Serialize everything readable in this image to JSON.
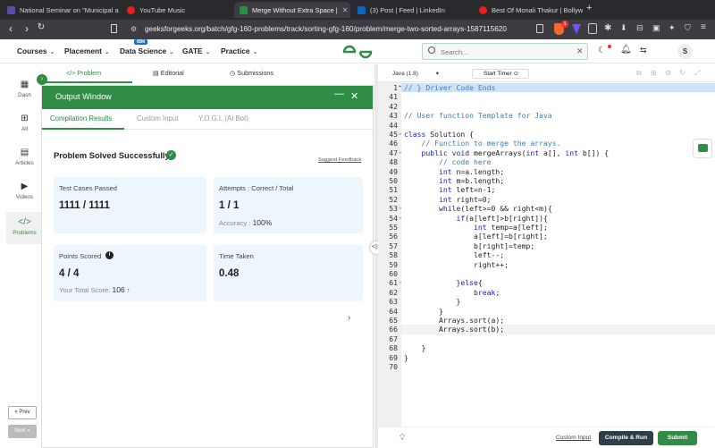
{
  "browser": {
    "tabs": [
      {
        "title": "National Seminar on \"Municipal a",
        "favicon_color": "#5a4ba7"
      },
      {
        "title": "YouTube Music",
        "favicon_color": "#e62117"
      },
      {
        "title": "Merge Without Extra Space |",
        "favicon_color": "#2f8d46"
      },
      {
        "title": "(3) Post | Feed | LinkedIn",
        "favicon_color": "#0a66c2"
      },
      {
        "title": "Best Of Monali Thakur | Bollywoo",
        "favicon_color": "#e62117"
      }
    ],
    "new_tab": "+",
    "url": "geeksforgeeks.org/batch/gfg-160-problems/track/sorting-gfg-160/problem/merge-two-sorted-arrays-1587115620",
    "brave_badge": "1"
  },
  "header": {
    "menus": [
      {
        "label": "Courses"
      },
      {
        "label": "Placement"
      },
      {
        "label": "Data Science",
        "badge": "IBM"
      },
      {
        "label": "GATE"
      },
      {
        "label": "Practice"
      }
    ],
    "logo": "GfG",
    "search_placeholder": "Search...",
    "avatar_letter": "S"
  },
  "sidebar": {
    "items": [
      {
        "label": "Dash"
      },
      {
        "label": "All"
      },
      {
        "label": "Articles"
      },
      {
        "label": "Videos"
      },
      {
        "label": "Problems"
      }
    ],
    "prev_label": "Prev",
    "next_label": "Next"
  },
  "problem_tabs": [
    "Problem",
    "Editorial",
    "Submissions"
  ],
  "output": {
    "title": "Output Window",
    "tabs": [
      "Compilation Results",
      "Custom Input",
      "Y.O.G.I. (AI Bot)"
    ],
    "status": "Problem Solved Successfully",
    "feedback_link": "Suggest Feedback",
    "cards": {
      "testcases_label": "Test Cases Passed",
      "testcases_value": "1111 / 1111",
      "attempts_label": "Attempts : Correct / Total",
      "attempts_value": "1 / 1",
      "accuracy_label": "Accuracy :",
      "accuracy_value": "100%",
      "points_label": "Points Scored",
      "points_value": "4 / 4",
      "total_score_label": "Your Total Score:",
      "total_score_value": "106",
      "time_label": "Time Taken",
      "time_value": "0.48"
    }
  },
  "editor": {
    "language": "Java (1.8)",
    "timer_label": "Start Timer",
    "lines": [
      {
        "n": "1",
        "text": "// } Driver Code Ends",
        "kind": "comment",
        "highlight": true
      },
      {
        "n": "41",
        "text": ""
      },
      {
        "n": "42",
        "text": ""
      },
      {
        "n": "43",
        "text": "// User function Template for Java",
        "kind": "comment"
      },
      {
        "n": "44",
        "text": ""
      },
      {
        "n": "45",
        "text": "class Solution {"
      },
      {
        "n": "46",
        "text": "    // Function to merge the arrays.",
        "kind": "comment"
      },
      {
        "n": "47",
        "text": "    public void mergeArrays(int a[], int b[]) {"
      },
      {
        "n": "48",
        "text": "        // code here",
        "kind": "comment"
      },
      {
        "n": "49",
        "text": "        int n=a.length;"
      },
      {
        "n": "50",
        "text": "        int m=b.length;"
      },
      {
        "n": "51",
        "text": "        int left=n-1;"
      },
      {
        "n": "52",
        "text": "        int right=0;"
      },
      {
        "n": "53",
        "text": "        while(left>=0 && right<m){"
      },
      {
        "n": "54",
        "text": "            if(a[left]>b[right]){"
      },
      {
        "n": "55",
        "text": "                int temp=a[left];"
      },
      {
        "n": "56",
        "text": "                a[left]=b[right];"
      },
      {
        "n": "57",
        "text": "                b[right]=temp;"
      },
      {
        "n": "58",
        "text": "                left--;"
      },
      {
        "n": "59",
        "text": "                right++;"
      },
      {
        "n": "60",
        "text": ""
      },
      {
        "n": "61",
        "text": "            }else{"
      },
      {
        "n": "62",
        "text": "                break;"
      },
      {
        "n": "63",
        "text": "            }"
      },
      {
        "n": "64",
        "text": "        }"
      },
      {
        "n": "65",
        "text": "        Arrays.sort(a);"
      },
      {
        "n": "66",
        "text": "        Arrays.sort(b);",
        "current": true
      },
      {
        "n": "67",
        "text": ""
      },
      {
        "n": "68",
        "text": "    }"
      },
      {
        "n": "69",
        "text": "}"
      },
      {
        "n": "70",
        "text": ""
      }
    ],
    "custom_input_label": "Custom Input",
    "compile_label": "Compile & Run",
    "submit_label": "Submit"
  },
  "colors": {
    "brand_green": "#2f8d46",
    "submit_green": "#2f8d46",
    "card_bg": "#eef6fd",
    "compile_bg": "#2d3e4a"
  }
}
